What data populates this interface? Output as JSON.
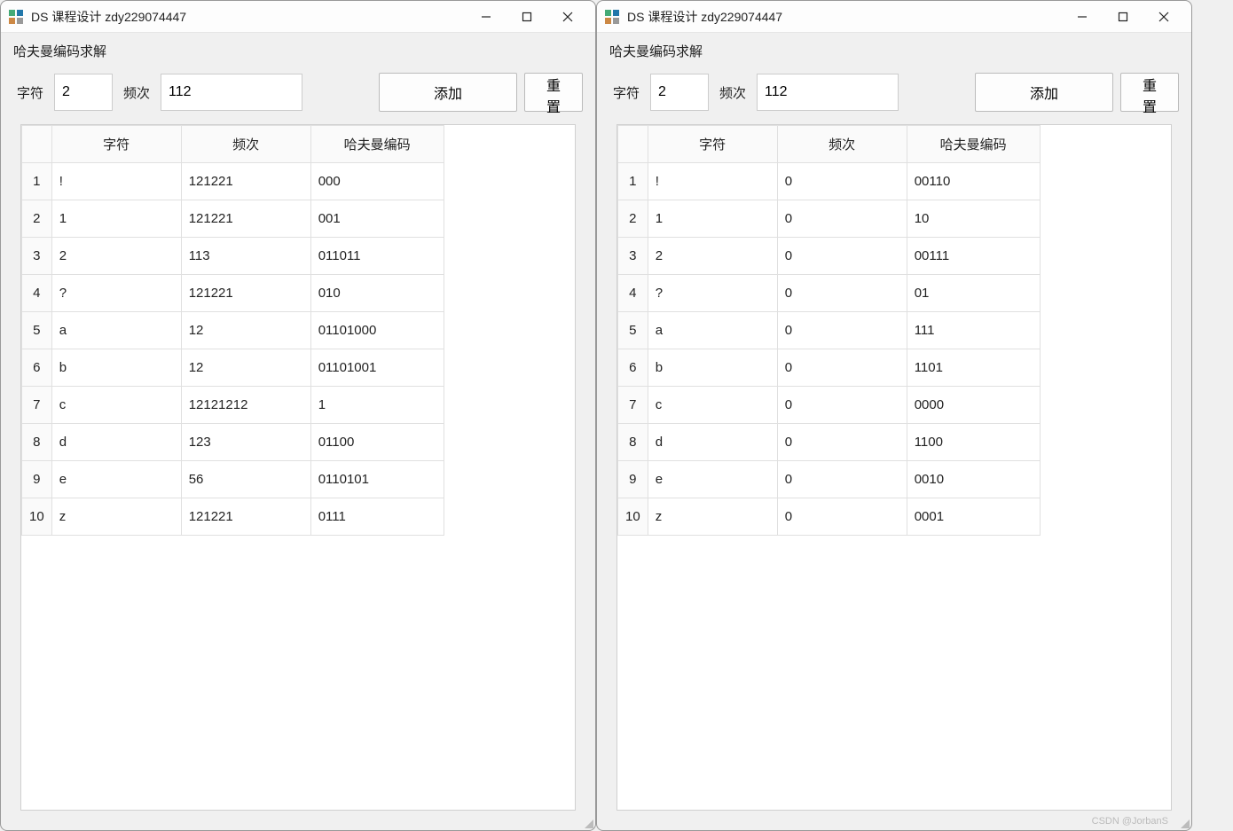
{
  "windows": [
    {
      "title": "DS 课程设计 zdy229074447",
      "subtitle": "哈夫曼编码求解",
      "toolbar": {
        "char_label": "字符",
        "char_value": "2",
        "freq_label": "频次",
        "freq_value": "112",
        "add_label": "添加",
        "reset_label": "重置"
      },
      "table": {
        "headers": {
          "char": "字符",
          "freq": "频次",
          "code": "哈夫曼编码"
        },
        "rows": [
          {
            "n": "1",
            "char": "!",
            "freq": "121221",
            "code": "000"
          },
          {
            "n": "2",
            "char": "1",
            "freq": "121221",
            "code": "001"
          },
          {
            "n": "3",
            "char": "2",
            "freq": "113",
            "code": "011011"
          },
          {
            "n": "4",
            "char": "?",
            "freq": "121221",
            "code": "010"
          },
          {
            "n": "5",
            "char": "a",
            "freq": "12",
            "code": "01101000"
          },
          {
            "n": "6",
            "char": "b",
            "freq": "12",
            "code": "01101001"
          },
          {
            "n": "7",
            "char": "c",
            "freq": "12121212",
            "code": "1"
          },
          {
            "n": "8",
            "char": "d",
            "freq": "123",
            "code": "01100"
          },
          {
            "n": "9",
            "char": "e",
            "freq": "56",
            "code": "0110101"
          },
          {
            "n": "10",
            "char": "z",
            "freq": "121221",
            "code": "0111"
          }
        ]
      }
    },
    {
      "title": "DS 课程设计 zdy229074447",
      "subtitle": "哈夫曼编码求解",
      "toolbar": {
        "char_label": "字符",
        "char_value": "2",
        "freq_label": "频次",
        "freq_value": "112",
        "add_label": "添加",
        "reset_label": "重置"
      },
      "table": {
        "headers": {
          "char": "字符",
          "freq": "频次",
          "code": "哈夫曼编码"
        },
        "rows": [
          {
            "n": "1",
            "char": "!",
            "freq": "0",
            "code": "00110"
          },
          {
            "n": "2",
            "char": "1",
            "freq": "0",
            "code": "10"
          },
          {
            "n": "3",
            "char": "2",
            "freq": "0",
            "code": "00111"
          },
          {
            "n": "4",
            "char": "?",
            "freq": "0",
            "code": "01"
          },
          {
            "n": "5",
            "char": "a",
            "freq": "0",
            "code": "111"
          },
          {
            "n": "6",
            "char": "b",
            "freq": "0",
            "code": "1101"
          },
          {
            "n": "7",
            "char": "c",
            "freq": "0",
            "code": "0000"
          },
          {
            "n": "8",
            "char": "d",
            "freq": "0",
            "code": "1100"
          },
          {
            "n": "9",
            "char": "e",
            "freq": "0",
            "code": "0010"
          },
          {
            "n": "10",
            "char": "z",
            "freq": "0",
            "code": "0001"
          }
        ]
      }
    }
  ],
  "watermark": "CSDN @JorbanS"
}
